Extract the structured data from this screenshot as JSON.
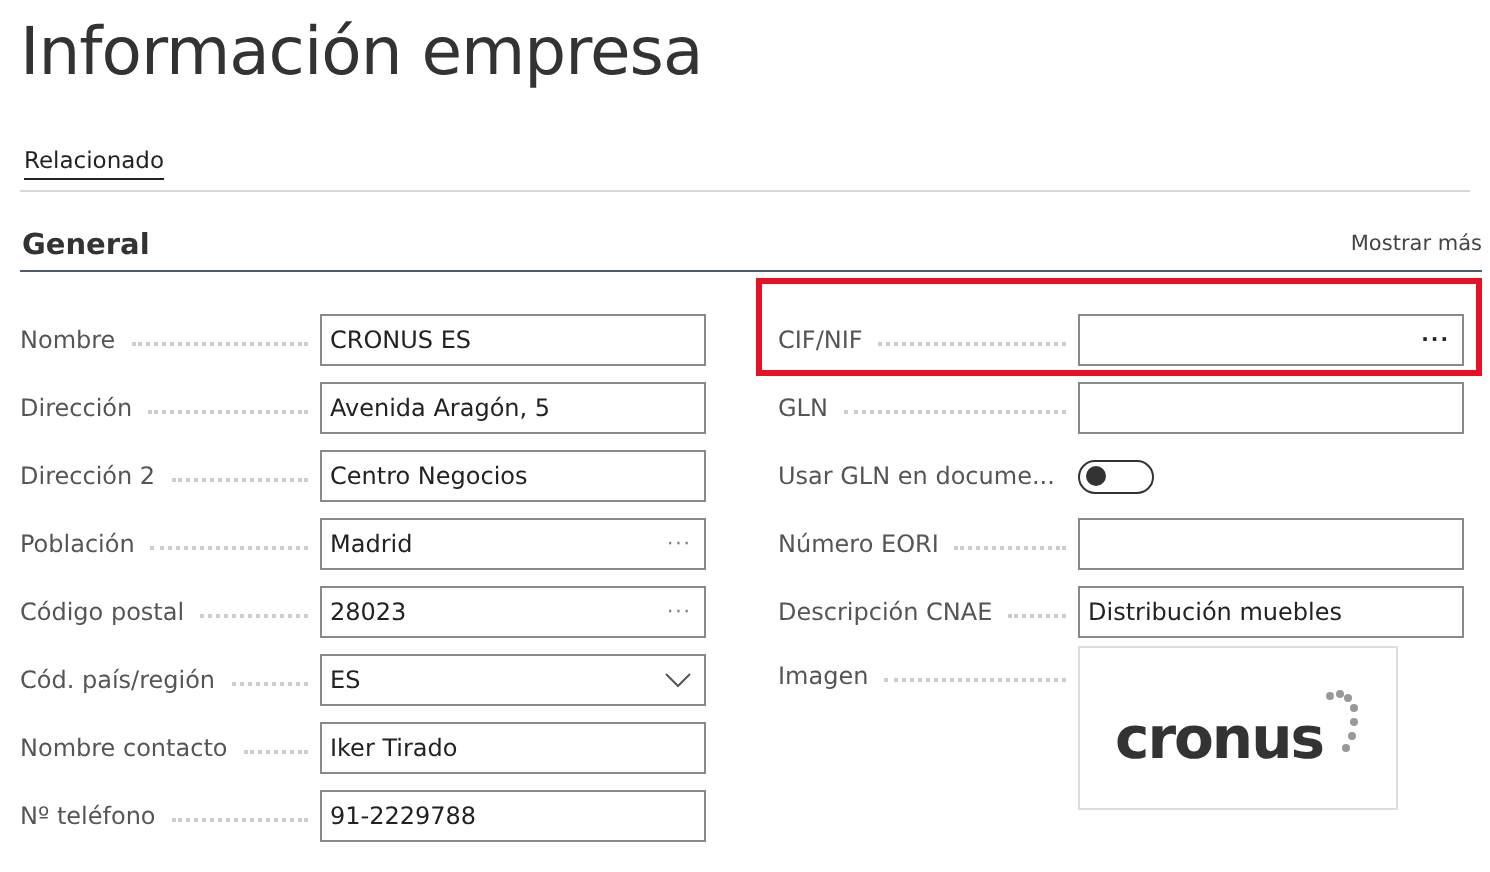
{
  "title": "Información empresa",
  "actions": [
    {
      "label": "Relacionado",
      "selected": true
    }
  ],
  "section": {
    "title": "General",
    "show_more": "Mostrar más"
  },
  "left_fields": [
    {
      "kind": "text",
      "label": "Nombre",
      "value": "CRONUS ES"
    },
    {
      "kind": "text",
      "label": "Dirección",
      "value": "Avenida Aragón, 5"
    },
    {
      "kind": "text",
      "label": "Dirección 2",
      "value": "Centro Negocios"
    },
    {
      "kind": "lookup",
      "label": "Población",
      "value": "Madrid",
      "button": "···"
    },
    {
      "kind": "lookup",
      "label": "Código postal",
      "value": "28023",
      "button": "···"
    },
    {
      "kind": "dropdown",
      "label": "Cód. país/región",
      "value": "ES"
    },
    {
      "kind": "text",
      "label": "Nombre contacto",
      "value": "Iker Tirado"
    },
    {
      "kind": "text",
      "label": "Nº teléfono",
      "value": "91-2229788"
    }
  ],
  "right_fields": [
    {
      "kind": "lookup",
      "label": "CIF/NIF",
      "button": "···",
      "highlighted": true
    },
    {
      "kind": "text",
      "label": "GLN"
    },
    {
      "kind": "toggle",
      "label": "Usar GLN en docume...",
      "on": false
    },
    {
      "kind": "text",
      "label": "Número EORI"
    },
    {
      "kind": "text",
      "label": "Descripción CNAE",
      "value": "Distribución muebles"
    },
    {
      "kind": "image",
      "label": "Imagen",
      "logo_text": "cronus"
    }
  ]
}
